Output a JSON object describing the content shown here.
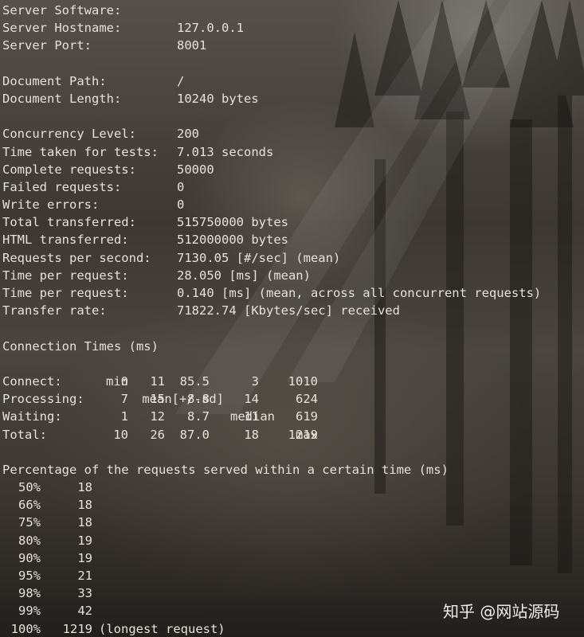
{
  "server": [
    {
      "key": "Server Software:",
      "value": ""
    },
    {
      "key": "Server Hostname:",
      "value": "127.0.0.1"
    },
    {
      "key": "Server Port:",
      "value": "8001"
    }
  ],
  "document": [
    {
      "key": "Document Path:",
      "value": "/"
    },
    {
      "key": "Document Length:",
      "value": "10240 bytes"
    }
  ],
  "stats": [
    {
      "key": "Concurrency Level:",
      "value": "200"
    },
    {
      "key": "Time taken for tests:",
      "value": "7.013 seconds"
    },
    {
      "key": "Complete requests:",
      "value": "50000"
    },
    {
      "key": "Failed requests:",
      "value": "0"
    },
    {
      "key": "Write errors:",
      "value": "0"
    },
    {
      "key": "Total transferred:",
      "value": "515750000 bytes"
    },
    {
      "key": "HTML transferred:",
      "value": "512000000 bytes"
    },
    {
      "key": "Requests per second:",
      "value": "7130.05 [#/sec] (mean)"
    },
    {
      "key": "Time per request:",
      "value": "28.050 [ms] (mean)"
    },
    {
      "key": "Time per request:",
      "value": "0.140 [ms] (mean, across all concurrent requests)"
    },
    {
      "key": "Transfer rate:",
      "value": "71822.74 [Kbytes/sec] received"
    }
  ],
  "connection_times": {
    "title": "Connection Times (ms)",
    "headers": [
      "min",
      "mean[+/-sd]",
      "median",
      "max"
    ],
    "rows": [
      {
        "label": "Connect:",
        "min": "0",
        "mean": "11",
        "sd": "85.5",
        "median": "3",
        "max": "1010"
      },
      {
        "label": "Processing:",
        "min": "7",
        "mean": "15",
        "sd": "8.8",
        "median": "14",
        "max": "624"
      },
      {
        "label": "Waiting:",
        "min": "1",
        "mean": "12",
        "sd": "8.7",
        "median": "11",
        "max": "619"
      },
      {
        "label": "Total:",
        "min": "10",
        "mean": "26",
        "sd": "87.0",
        "median": "18",
        "max": "1219"
      }
    ]
  },
  "percentiles": {
    "title": "Percentage of the requests served within a certain time (ms)",
    "rows": [
      {
        "pct": "50%",
        "ms": "18",
        "note": ""
      },
      {
        "pct": "66%",
        "ms": "18",
        "note": ""
      },
      {
        "pct": "75%",
        "ms": "18",
        "note": ""
      },
      {
        "pct": "80%",
        "ms": "19",
        "note": ""
      },
      {
        "pct": "90%",
        "ms": "19",
        "note": ""
      },
      {
        "pct": "95%",
        "ms": "21",
        "note": ""
      },
      {
        "pct": "98%",
        "ms": "33",
        "note": ""
      },
      {
        "pct": "99%",
        "ms": "42",
        "note": ""
      },
      {
        "pct": "100%",
        "ms": "1219",
        "note": "(longest request)"
      }
    ]
  },
  "watermark": "知乎 @网站源码"
}
